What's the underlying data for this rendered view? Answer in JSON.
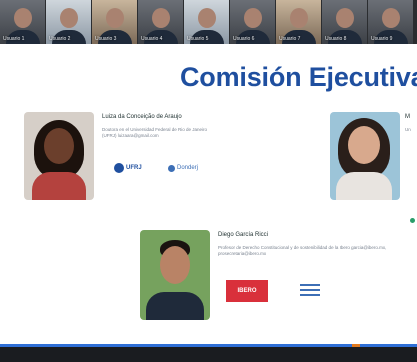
{
  "meeting": {
    "participants": [
      {
        "name": "Usuario 1",
        "variant": "plain"
      },
      {
        "name": "Usuario 2",
        "variant": "bright"
      },
      {
        "name": "Usuario 3",
        "variant": "warm"
      },
      {
        "name": "Usuario 4",
        "variant": "plain"
      },
      {
        "name": "Usuario 5",
        "variant": "bright"
      },
      {
        "name": "Usuario 6",
        "variant": "plain"
      },
      {
        "name": "Usuario 7",
        "variant": "warm"
      },
      {
        "name": "Usuario 8",
        "variant": "plain"
      },
      {
        "name": "Usuario 9",
        "variant": "plain"
      }
    ]
  },
  "slide": {
    "title": "Comisión Ejecutiva",
    "members": [
      {
        "name": "Luiza da Conceição de Araujo",
        "description": "Doutora en el Universidad Federal de Rio de Janeiro (UFRJ) luizaara@gmail.com",
        "logos": [
          "UFRJ",
          "Donderj"
        ]
      },
      {
        "name": "M",
        "description": "Un",
        "logos": []
      },
      {
        "name": "Diego García Ricci",
        "description": "Profesor de Derecho Constitucional y de sostenibilidad de la Ibero garcia@ibero.mx, prosecretaria@ibero.mx",
        "logos": [
          "IBERO",
          "Ibero Blue"
        ]
      }
    ]
  },
  "colors": {
    "title": "#1f4f9f",
    "bar_accent": "#2f6fd6",
    "red_logo": "#d9303b"
  },
  "icons": {
    "ufrj": "ufrj-logo-icon",
    "donderj": "donderj-logo-icon",
    "ibero_red": "ibero-red-logo-icon",
    "ibero_blue": "ibero-blue-logo-icon"
  }
}
